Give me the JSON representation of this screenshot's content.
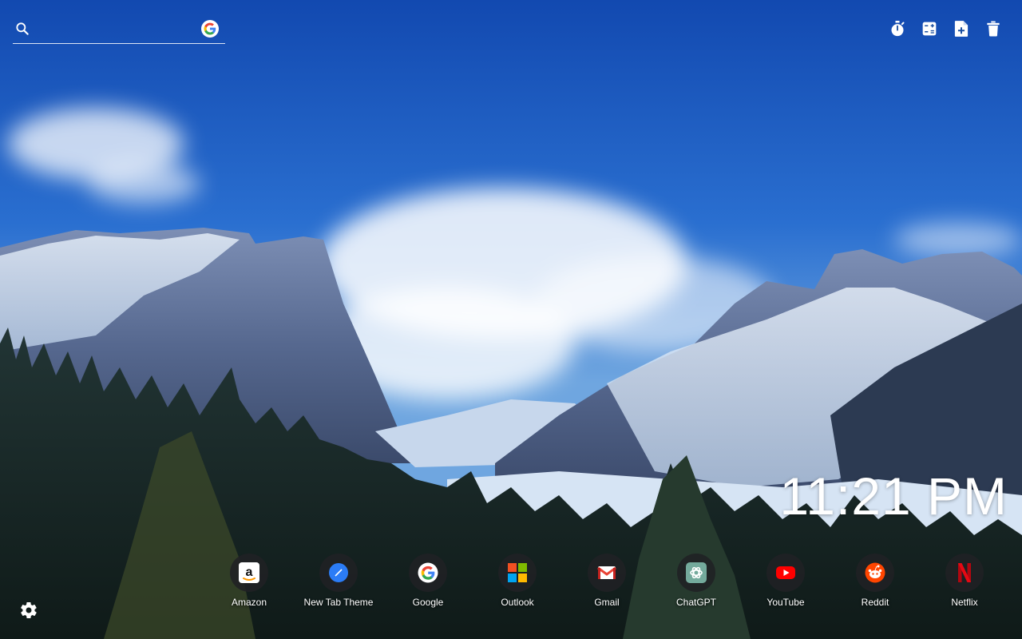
{
  "search": {
    "value": "",
    "placeholder": "",
    "engine_icon": "google-logo-icon",
    "icon": "search-icon"
  },
  "toolbar": [
    {
      "name": "stopwatch-button",
      "icon": "stopwatch-icon"
    },
    {
      "name": "calculator-button",
      "icon": "calculator-icon"
    },
    {
      "name": "add-note-button",
      "icon": "note-add-icon"
    },
    {
      "name": "trash-button",
      "icon": "trash-icon"
    }
  ],
  "clock": {
    "time": "11:21 PM"
  },
  "shortcuts": [
    {
      "label": "Amazon",
      "icon": "amazon-icon",
      "color": "#ffffff"
    },
    {
      "label": "New Tab Theme",
      "icon": "compass-icon",
      "color": "#2b7cf6"
    },
    {
      "label": "Google",
      "icon": "google-icon",
      "color": "#ffffff"
    },
    {
      "label": "Outlook",
      "icon": "microsoft-icon",
      "color": "#f25022"
    },
    {
      "label": "Gmail",
      "icon": "gmail-icon",
      "color": "#ea4335"
    },
    {
      "label": "ChatGPT",
      "icon": "chatgpt-icon",
      "color": "#74aa9c"
    },
    {
      "label": "YouTube",
      "icon": "youtube-icon",
      "color": "#ff0000"
    },
    {
      "label": "Reddit",
      "icon": "reddit-icon",
      "color": "#ff4500"
    },
    {
      "label": "Netflix",
      "icon": "netflix-icon",
      "color": "#e50914"
    }
  ],
  "settings": {
    "icon": "gear-icon"
  },
  "background": {
    "sky": "#1e5bc0",
    "snow": "#dce8f5",
    "forest": "#1c2a2a"
  }
}
